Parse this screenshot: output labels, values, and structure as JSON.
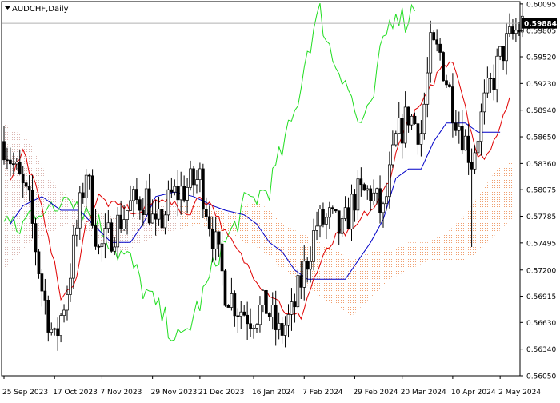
{
  "window": {
    "title": "AUDCHF,Daily",
    "title_icon": "triangle-down-icon"
  },
  "colors": {
    "background": "#ffffff",
    "frame": "#000000",
    "candle": "#000000",
    "tenkan": "#e00000",
    "kijun": "#0000c8",
    "chikou": "#22dd22",
    "cloud": "#f0a070",
    "cloud_bear": "#d8b8b8",
    "price_label_bg": "#000000",
    "price_label_text": "#ffffff",
    "current_price_line": "#b0b0b0"
  },
  "chart_data": {
    "type": "candlestick",
    "title": "AUDCHF,Daily",
    "symbol": "AUDCHF",
    "timeframe": "Daily",
    "current_price": "0.59884",
    "ylim": [
      0.5605,
      0.6012
    ],
    "y_ticks": [
      "0.60095",
      "0.59805",
      "0.59520",
      "0.59230",
      "0.58940",
      "0.58650",
      "0.58360",
      "0.58075",
      "0.57785",
      "0.57495",
      "0.57200",
      "0.56915",
      "0.56630",
      "0.56340",
      "0.56050"
    ],
    "x_ticks": [
      "25 Sep 2023",
      "17 Oct 2023",
      "7 Nov 2023",
      "29 Nov 2023",
      "21 Dec 2023",
      "16 Jan 2024",
      "7 Feb 2024",
      "29 Feb 2024",
      "20 Mar 2024",
      "10 Apr 2024",
      "2 May 2024"
    ],
    "x_tick_bar_index": [
      0,
      16,
      31,
      47,
      62,
      79,
      95,
      111,
      126,
      142,
      157
    ],
    "bars": 165,
    "keypoints": [
      [
        0,
        0.586
      ],
      [
        8,
        0.579
      ],
      [
        12,
        0.57
      ],
      [
        16,
        0.564
      ],
      [
        20,
        0.57
      ],
      [
        26,
        0.583
      ],
      [
        30,
        0.574
      ],
      [
        34,
        0.576
      ],
      [
        40,
        0.579
      ],
      [
        45,
        0.58
      ],
      [
        48,
        0.576
      ],
      [
        53,
        0.58
      ],
      [
        58,
        0.581
      ],
      [
        62,
        0.582
      ],
      [
        66,
        0.576
      ],
      [
        70,
        0.57
      ],
      [
        74,
        0.568
      ],
      [
        78,
        0.567
      ],
      [
        83,
        0.568
      ],
      [
        87,
        0.565
      ],
      [
        91,
        0.567
      ],
      [
        95,
        0.572
      ],
      [
        99,
        0.577
      ],
      [
        103,
        0.5775
      ],
      [
        107,
        0.576
      ],
      [
        111,
        0.58
      ],
      [
        116,
        0.5805
      ],
      [
        120,
        0.578
      ],
      [
        124,
        0.586
      ],
      [
        128,
        0.589
      ],
      [
        132,
        0.587
      ],
      [
        135,
        0.596
      ],
      [
        138,
        0.5955
      ],
      [
        142,
        0.59
      ],
      [
        145,
        0.587
      ],
      [
        148,
        0.584
      ],
      [
        152,
        0.59
      ],
      [
        155,
        0.593
      ],
      [
        158,
        0.596
      ],
      [
        161,
        0.5975
      ],
      [
        164,
        0.5988
      ]
    ],
    "special_wicks": [
      {
        "bar": 148,
        "low": 0.5745
      }
    ],
    "tenkan_points": [
      [
        2,
        0.582
      ],
      [
        6,
        0.585
      ],
      [
        10,
        0.581
      ],
      [
        14,
        0.576
      ],
      [
        18,
        0.569
      ],
      [
        22,
        0.57
      ],
      [
        26,
        0.577
      ],
      [
        30,
        0.58
      ],
      [
        34,
        0.579
      ],
      [
        38,
        0.579
      ],
      [
        42,
        0.578
      ],
      [
        46,
        0.579
      ],
      [
        50,
        0.58
      ],
      [
        54,
        0.579
      ],
      [
        58,
        0.578
      ],
      [
        62,
        0.58
      ],
      [
        66,
        0.579
      ],
      [
        70,
        0.576
      ],
      [
        74,
        0.574
      ],
      [
        78,
        0.572
      ],
      [
        82,
        0.57
      ],
      [
        86,
        0.569
      ],
      [
        90,
        0.567
      ],
      [
        94,
        0.567
      ],
      [
        98,
        0.571
      ],
      [
        102,
        0.574
      ],
      [
        106,
        0.576
      ],
      [
        110,
        0.576
      ],
      [
        114,
        0.578
      ],
      [
        118,
        0.579
      ],
      [
        122,
        0.582
      ],
      [
        126,
        0.587
      ],
      [
        130,
        0.589
      ],
      [
        134,
        0.591
      ],
      [
        138,
        0.594
      ],
      [
        142,
        0.595
      ],
      [
        146,
        0.59
      ],
      [
        150,
        0.584
      ],
      [
        154,
        0.585
      ],
      [
        157,
        0.588
      ],
      [
        160,
        0.591
      ]
    ],
    "kijun_points": [
      [
        2,
        0.577
      ],
      [
        6,
        0.579
      ],
      [
        12,
        0.58
      ],
      [
        18,
        0.5785
      ],
      [
        24,
        0.5785
      ],
      [
        28,
        0.577
      ],
      [
        34,
        0.575
      ],
      [
        40,
        0.575
      ],
      [
        44,
        0.577
      ],
      [
        48,
        0.58
      ],
      [
        54,
        0.5805
      ],
      [
        60,
        0.58
      ],
      [
        66,
        0.579
      ],
      [
        70,
        0.5785
      ],
      [
        76,
        0.578
      ],
      [
        80,
        0.577
      ],
      [
        84,
        0.575
      ],
      [
        88,
        0.574
      ],
      [
        92,
        0.572
      ],
      [
        96,
        0.571
      ],
      [
        100,
        0.571
      ],
      [
        104,
        0.571
      ],
      [
        108,
        0.571
      ],
      [
        112,
        0.573
      ],
      [
        116,
        0.575
      ],
      [
        120,
        0.5775
      ],
      [
        124,
        0.582
      ],
      [
        128,
        0.583
      ],
      [
        132,
        0.583
      ],
      [
        136,
        0.586
      ],
      [
        140,
        0.588
      ],
      [
        146,
        0.588
      ],
      [
        150,
        0.587
      ],
      [
        154,
        0.587
      ],
      [
        157,
        0.587
      ]
    ],
    "chikou_points": [
      [
        0,
        0.578
      ],
      [
        4,
        0.576
      ],
      [
        8,
        0.578
      ],
      [
        12,
        0.579
      ],
      [
        16,
        0.578
      ],
      [
        20,
        0.581
      ],
      [
        24,
        0.579
      ],
      [
        28,
        0.578
      ],
      [
        32,
        0.576
      ],
      [
        36,
        0.574
      ],
      [
        40,
        0.573
      ],
      [
        44,
        0.57
      ],
      [
        48,
        0.568
      ],
      [
        52,
        0.566
      ],
      [
        56,
        0.564
      ],
      [
        60,
        0.567
      ],
      [
        64,
        0.57
      ],
      [
        68,
        0.574
      ],
      [
        72,
        0.576
      ],
      [
        76,
        0.579
      ],
      [
        80,
        0.58
      ],
      [
        84,
        0.581
      ],
      [
        88,
        0.585
      ],
      [
        92,
        0.589
      ],
      [
        96,
        0.596
      ],
      [
        100,
        0.6
      ],
      [
        104,
        0.595
      ],
      [
        108,
        0.593
      ],
      [
        112,
        0.588
      ],
      [
        116,
        0.589
      ],
      [
        120,
        0.597
      ],
      [
        124,
        0.6005
      ],
      [
        127,
        0.599
      ],
      [
        130,
        0.601
      ]
    ],
    "cloud_points": [
      [
        0,
        0.588,
        0.572
      ],
      [
        8,
        0.586,
        0.575
      ],
      [
        14,
        0.582,
        0.576
      ],
      [
        20,
        0.58,
        0.577
      ],
      [
        26,
        0.579,
        0.576
      ],
      [
        32,
        0.578,
        0.575
      ],
      [
        38,
        0.5775,
        0.574
      ],
      [
        44,
        0.578,
        0.575
      ],
      [
        50,
        0.579,
        0.576
      ],
      [
        56,
        0.579,
        0.5765
      ],
      [
        62,
        0.579,
        0.577
      ],
      [
        68,
        0.5785,
        0.576
      ],
      [
        72,
        0.578,
        0.576
      ],
      [
        76,
        0.579,
        0.575
      ],
      [
        80,
        0.5795,
        0.5745
      ],
      [
        84,
        0.5785,
        0.5735
      ],
      [
        88,
        0.577,
        0.572
      ],
      [
        94,
        0.576,
        0.571
      ],
      [
        100,
        0.575,
        0.569
      ],
      [
        106,
        0.574,
        0.568
      ],
      [
        110,
        0.573,
        0.567
      ],
      [
        116,
        0.574,
        0.569
      ],
      [
        122,
        0.574,
        0.571
      ],
      [
        128,
        0.575,
        0.572
      ],
      [
        134,
        0.575,
        0.573
      ],
      [
        140,
        0.576,
        0.573
      ],
      [
        146,
        0.578,
        0.573
      ],
      [
        150,
        0.58,
        0.574
      ],
      [
        156,
        0.583,
        0.576
      ],
      [
        162,
        0.584,
        0.578
      ]
    ],
    "series": [
      {
        "name": "",
        "kind": "tenkan"
      },
      {
        "name": "",
        "kind": "kijun"
      },
      {
        "name": "",
        "kind": "chikou"
      },
      {
        "name": "",
        "kind": "cloud"
      }
    ]
  }
}
